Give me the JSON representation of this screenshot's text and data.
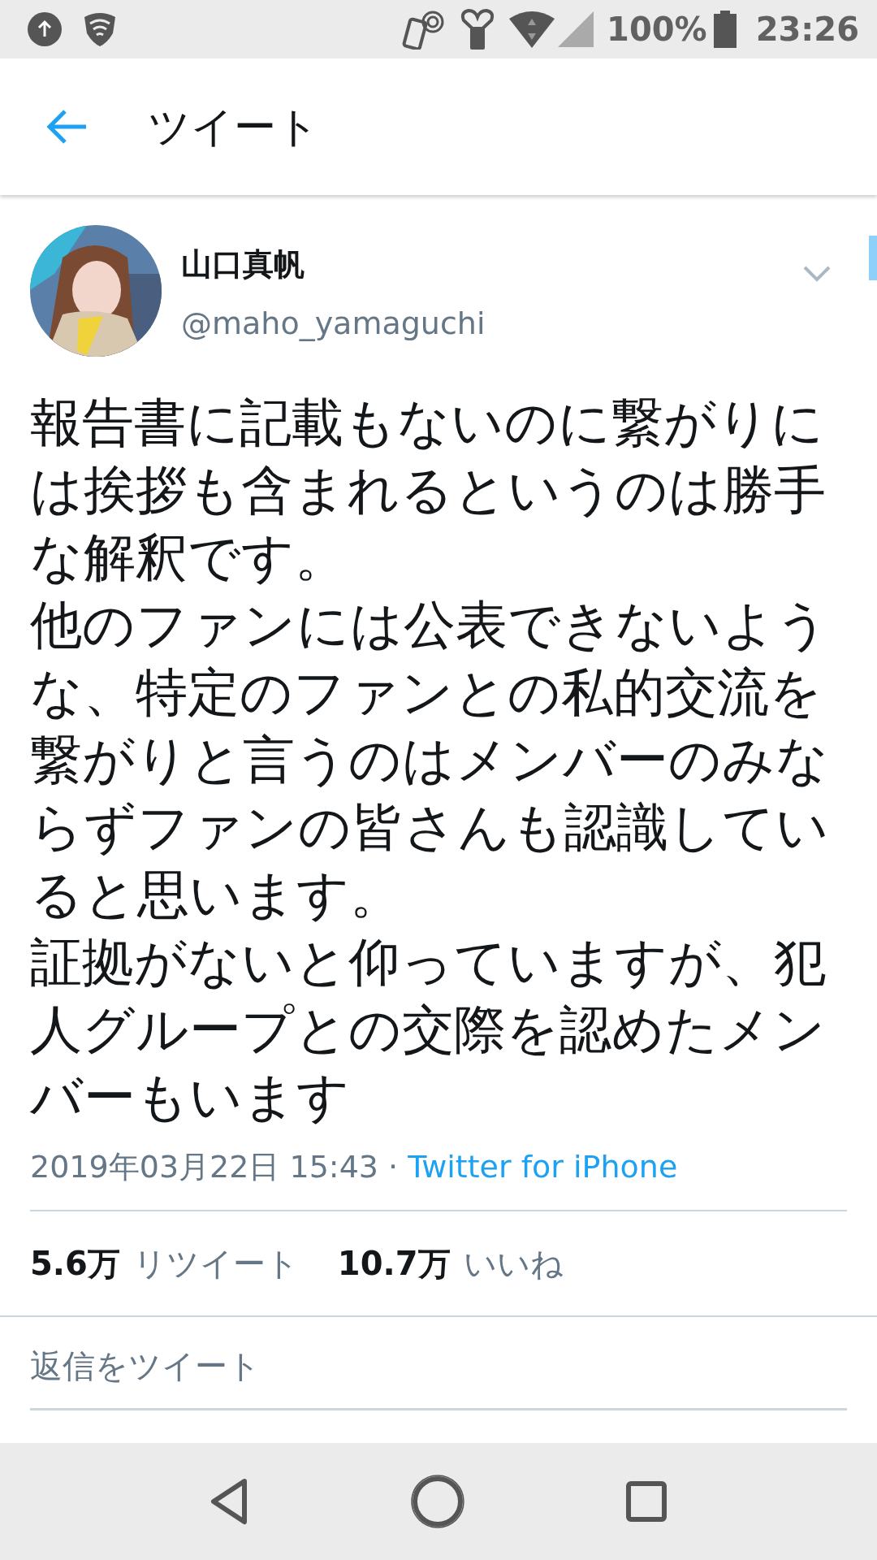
{
  "status_bar": {
    "battery": "100%",
    "time": "23:26"
  },
  "header": {
    "title": "ツイート"
  },
  "tweet": {
    "author": {
      "name": "山口真帆",
      "handle": "@maho_yamaguchi"
    },
    "paragraphs": [
      "報告書に記載もないのに繋がりには挨拶も含まれるというのは勝手な解釈です。",
      "他のファンには公表できないような、特定のファンとの私的交流を繋がりと言うのはメンバーのみならずファンの皆さんも認識していると思います。",
      "証拠がないと仰っていますが、犯人グループとの交際を認めたメンバーもいます"
    ],
    "timestamp": "2019年03月22日 15:43 ·",
    "source": "Twitter for iPhone",
    "stats": [
      {
        "count": "5.6万",
        "label": "リツイート"
      },
      {
        "count": "10.7万",
        "label": "いいね"
      }
    ]
  },
  "reply": {
    "placeholder": "返信をツイート"
  }
}
